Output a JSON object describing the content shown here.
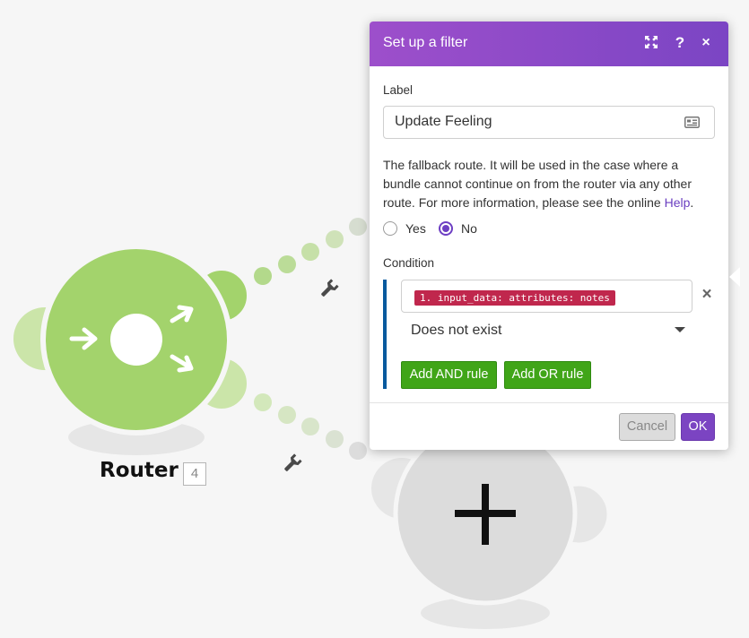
{
  "canvas": {
    "router_label": "Router",
    "router_id": "4"
  },
  "dialog": {
    "title": "Set up a filter",
    "header_icons": [
      "expand-icon",
      "help-icon",
      "close-icon"
    ],
    "help_glyph": "?",
    "close_glyph": "×",
    "label_field": {
      "label": "Label",
      "value": "Update Feeling"
    },
    "description": "The fallback route. It will be used in the case where a bundle cannot continue on from the router via any other route. For more information, please see the online ",
    "help_link": "Help",
    "description_end": ".",
    "fallback": {
      "options": [
        "Yes",
        "No"
      ],
      "selected": "No"
    },
    "condition": {
      "label": "Condition",
      "operand": "1. input_data: attributes: notes",
      "operator": "Does not exist",
      "remove_glyph": "×"
    },
    "buttons": {
      "add_and": "Add AND rule",
      "add_or": "Add OR rule",
      "cancel": "Cancel",
      "ok": "OK"
    }
  },
  "colors": {
    "router_green": "#a3d36c",
    "header_purple": "#8a4ac7",
    "pill_red": "#c0274d",
    "button_green": "#40a518",
    "condition_bar": "#07599e"
  }
}
